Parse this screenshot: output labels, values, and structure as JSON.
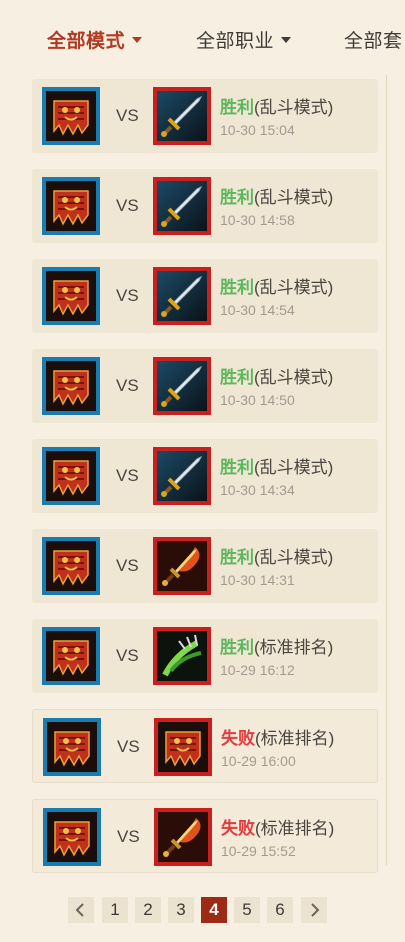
{
  "filters": [
    {
      "label": "全部模式",
      "active": true
    },
    {
      "label": "全部职业",
      "active": false
    },
    {
      "label": "全部套",
      "active": false
    }
  ],
  "matches": [
    {
      "vs": "VS",
      "outcome": "胜利",
      "mode": "(乱斗模式)",
      "time": "10-30 15:04",
      "opponent_icon": "sword-icon",
      "result_type": "win"
    },
    {
      "vs": "VS",
      "outcome": "胜利",
      "mode": "(乱斗模式)",
      "time": "10-30 14:58",
      "opponent_icon": "sword-icon",
      "result_type": "win"
    },
    {
      "vs": "VS",
      "outcome": "胜利",
      "mode": "(乱斗模式)",
      "time": "10-30 14:54",
      "opponent_icon": "sword-icon",
      "result_type": "win"
    },
    {
      "vs": "VS",
      "outcome": "胜利",
      "mode": "(乱斗模式)",
      "time": "10-30 14:50",
      "opponent_icon": "sword-icon",
      "result_type": "win"
    },
    {
      "vs": "VS",
      "outcome": "胜利",
      "mode": "(乱斗模式)",
      "time": "10-30 14:34",
      "opponent_icon": "sword-icon",
      "result_type": "win"
    },
    {
      "vs": "VS",
      "outcome": "胜利",
      "mode": "(乱斗模式)",
      "time": "10-30 14:31",
      "opponent_icon": "flaming-dagger-icon",
      "result_type": "win"
    },
    {
      "vs": "VS",
      "outcome": "胜利",
      "mode": "(标准排名)",
      "time": "10-29 16:12",
      "opponent_icon": "green-claw-icon",
      "result_type": "win"
    },
    {
      "vs": "VS",
      "outcome": "失败",
      "mode": "(标准排名)",
      "time": "10-29 16:00",
      "opponent_icon": "banner-icon",
      "result_type": "lose"
    },
    {
      "vs": "VS",
      "outcome": "失败",
      "mode": "(标准排名)",
      "time": "10-29 15:52",
      "opponent_icon": "flaming-dagger-icon",
      "result_type": "lose"
    }
  ],
  "my_hero_icon": "banner-icon",
  "colors": {
    "win": "#5cb85c",
    "lose": "#e53b3b",
    "accent": "#b23a22",
    "my_frame": "#1a7bb0",
    "opp_frame": "#c81f1f",
    "active_page": "#9c2a14"
  },
  "pagination": {
    "pages": [
      "1",
      "2",
      "3",
      "4",
      "5",
      "6"
    ],
    "current": "4",
    "prev_icon": "chevron-left-icon",
    "next_icon": "chevron-right-icon"
  }
}
